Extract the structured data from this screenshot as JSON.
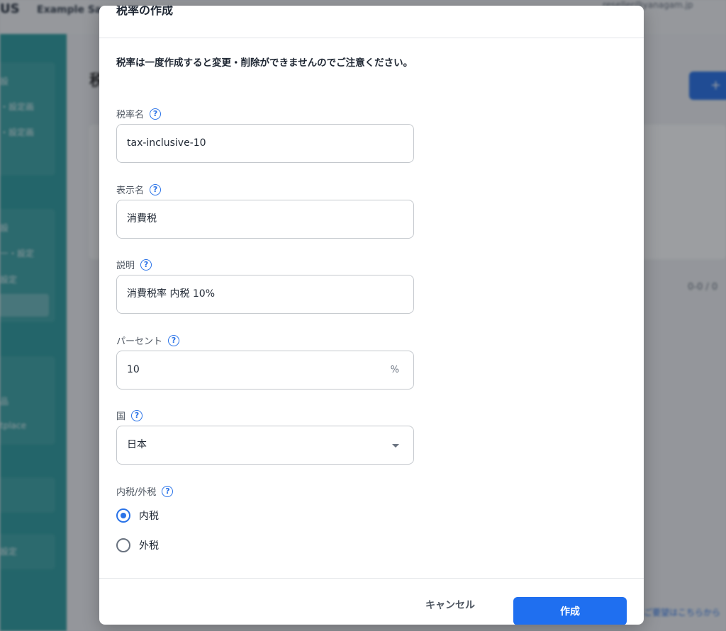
{
  "background": {
    "logo": "US",
    "company": "Example Sa",
    "user": "reseller@yanagam.jp",
    "page_title": "税",
    "add_button": "+",
    "pager": "0-0 / 0",
    "footer_link": "ご要望はこちらから",
    "nav_items": [
      "設",
      "・設定画",
      "・設定画",
      "設",
      "ー・設定",
      "設定",
      "品",
      "tplace",
      "設定"
    ]
  },
  "modal": {
    "title": "税率の作成",
    "warning": "税率は一度作成すると変更・削除ができませんのでご注意ください。",
    "fields": {
      "tax_name": {
        "label": "税率名",
        "value": "tax-inclusive-10"
      },
      "display_name": {
        "label": "表示名",
        "value": "消費税"
      },
      "description": {
        "label": "説明",
        "value": "消費税率 内税 10%"
      },
      "percent": {
        "label": "パーセント",
        "value": "10",
        "suffix": "%"
      },
      "country": {
        "label": "国",
        "value": "日本"
      }
    },
    "tax_type": {
      "label": "内税/外税",
      "options": [
        {
          "label": "内税",
          "checked": true
        },
        {
          "label": "外税",
          "checked": false
        }
      ]
    },
    "help_glyph": "?",
    "cancel_label": "キャンセル",
    "create_label": "作成"
  },
  "colors": {
    "accent": "#1f6ff0",
    "sidebar": "#2f9ea0",
    "overlay": "rgba(20,24,30,0.42)"
  }
}
